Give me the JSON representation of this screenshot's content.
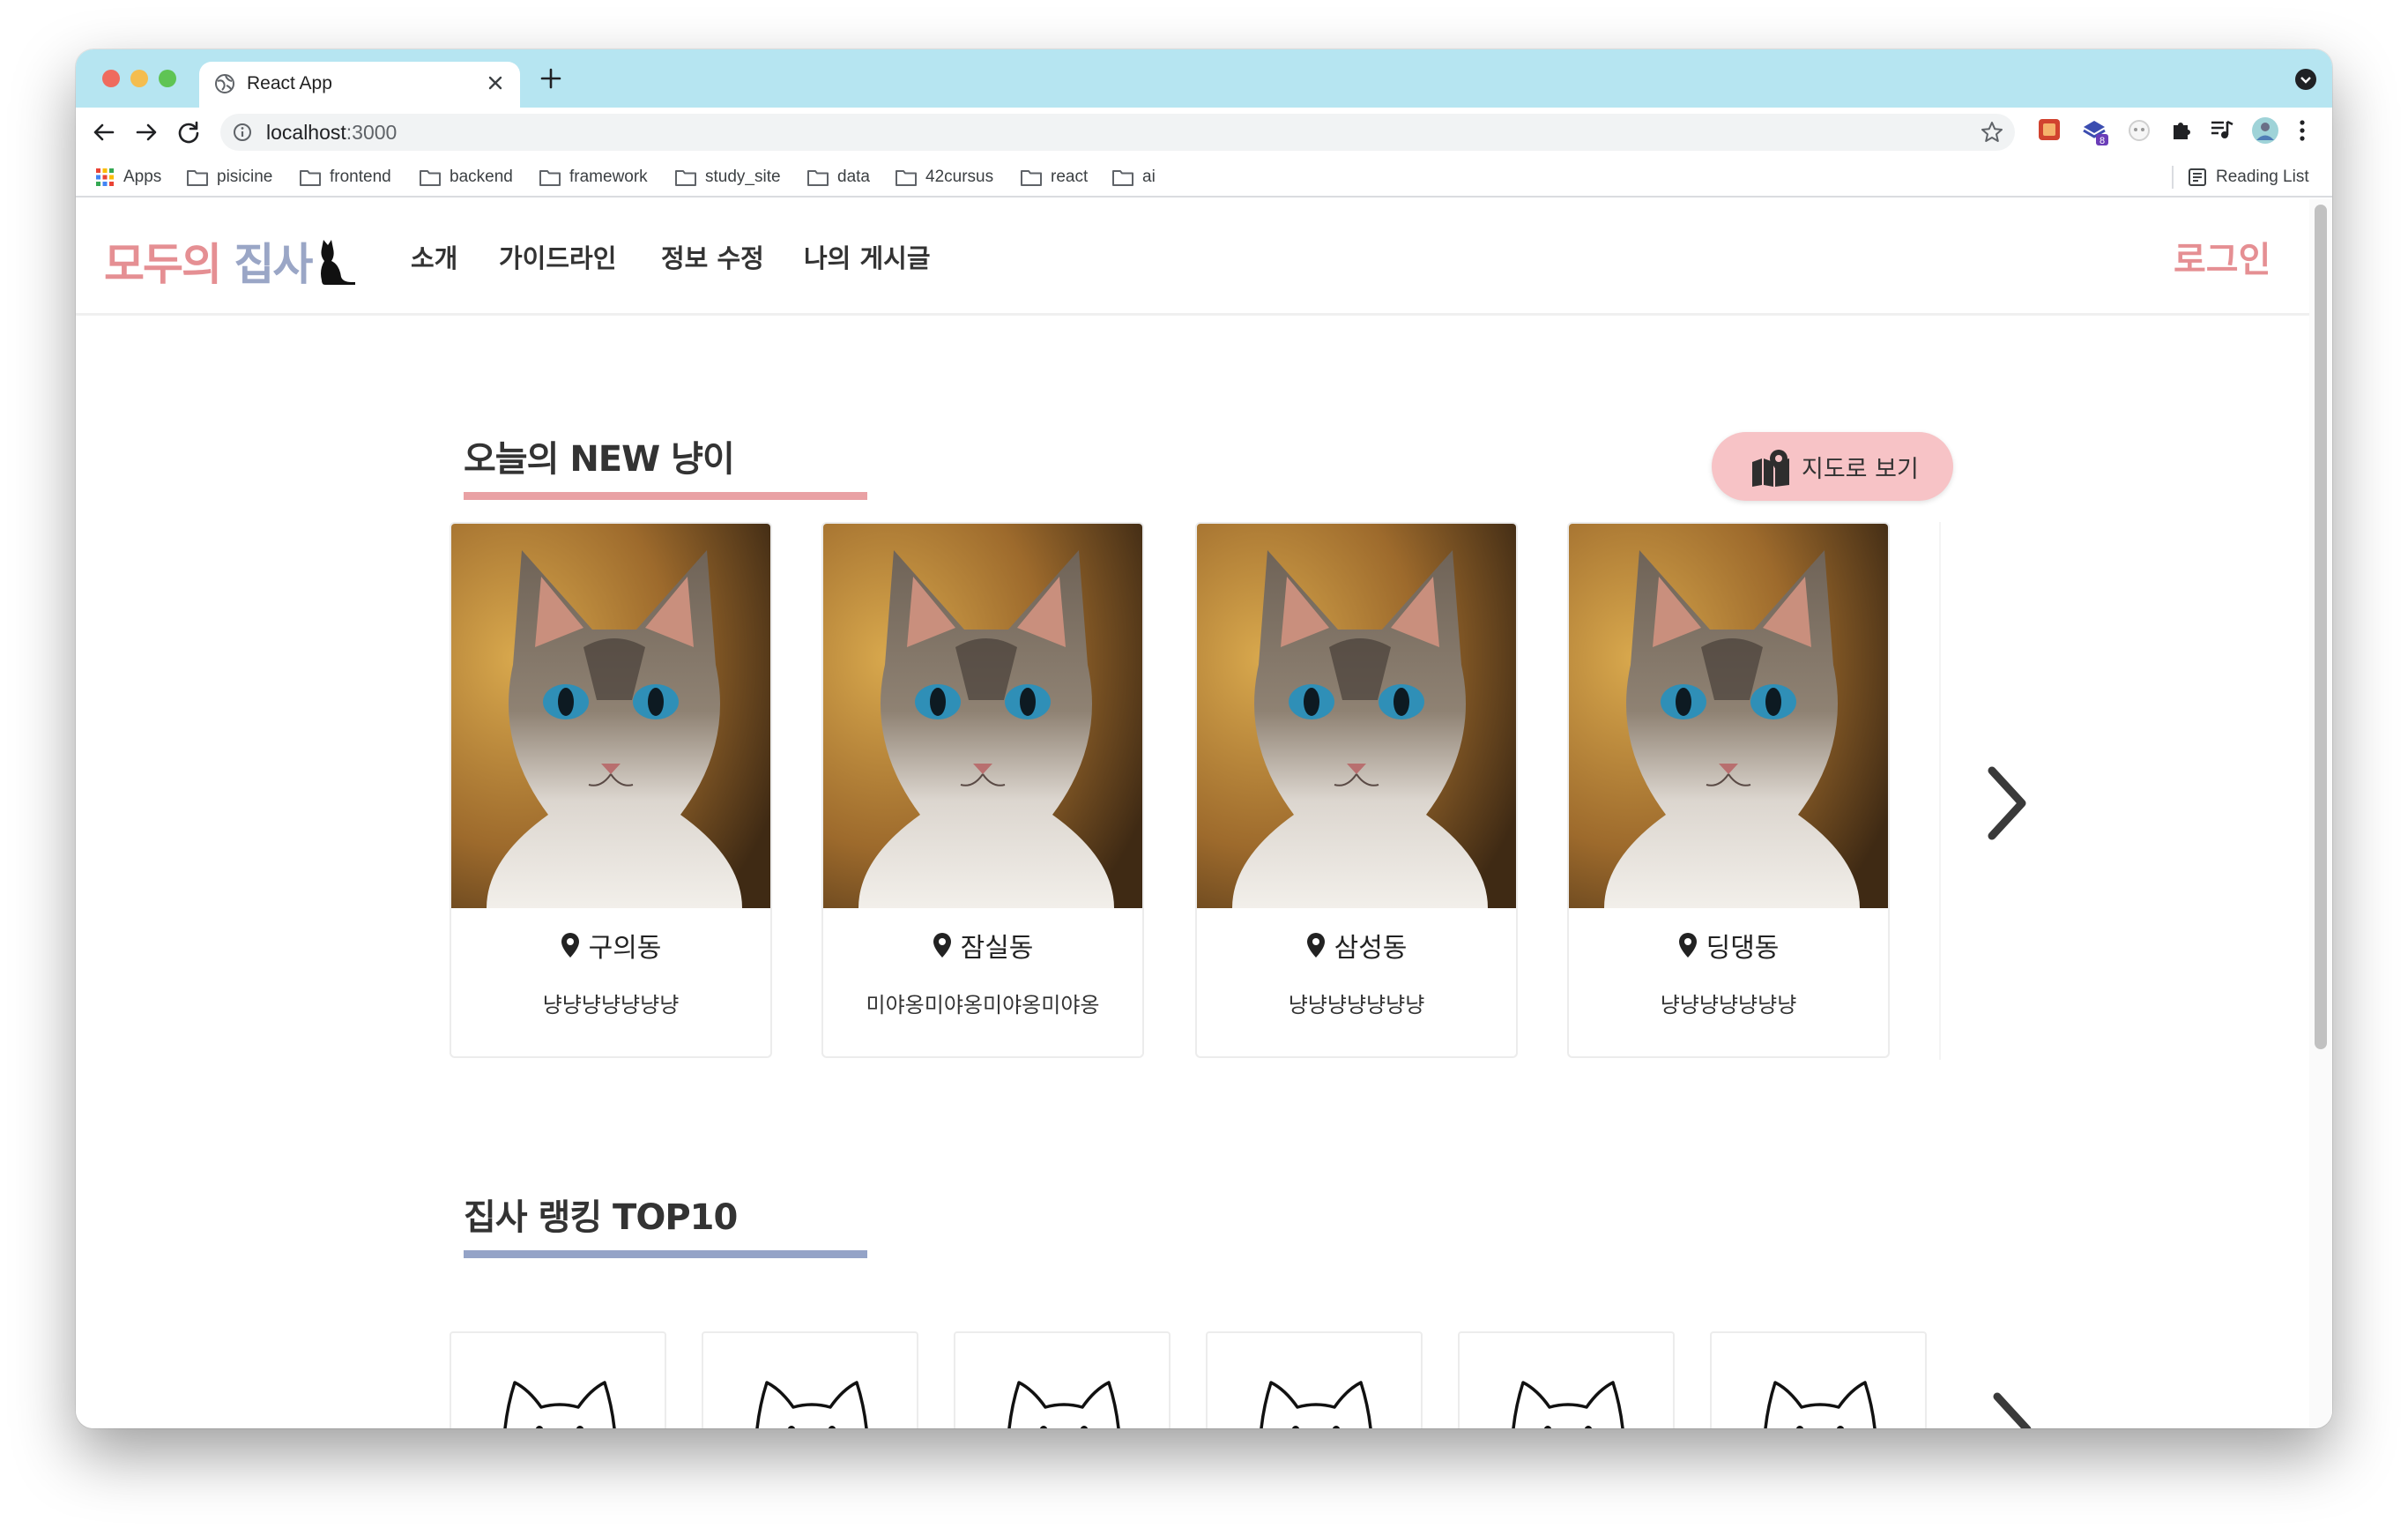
{
  "browser": {
    "tab_title": "React App",
    "url_host": "localhost",
    "url_port": ":3000",
    "bookmarks": [
      {
        "label": "Apps",
        "icon": "apps-grid-icon"
      },
      {
        "label": "pisicine",
        "icon": "folder-icon"
      },
      {
        "label": "frontend",
        "icon": "folder-icon"
      },
      {
        "label": "backend",
        "icon": "folder-icon"
      },
      {
        "label": "framework",
        "icon": "folder-icon"
      },
      {
        "label": "study_site",
        "icon": "folder-icon"
      },
      {
        "label": "data",
        "icon": "folder-icon"
      },
      {
        "label": "42cursus",
        "icon": "folder-icon"
      },
      {
        "label": "react",
        "icon": "folder-icon"
      },
      {
        "label": "ai",
        "icon": "folder-icon"
      }
    ],
    "reading_list": "Reading List",
    "extension_badge": "8"
  },
  "site": {
    "logo_part1": "모두의 ",
    "logo_part2": "집사",
    "nav": [
      "소개",
      "가이드라인",
      "정보 수정",
      "나의 게시글"
    ],
    "login": "로그인"
  },
  "today_section": {
    "title": "오늘의 NEW 냥이",
    "map_button": "지도로 보기",
    "cards": [
      {
        "location": "구의동",
        "description": "냥냥냥냥냥냥냥"
      },
      {
        "location": "잠실동",
        "description": "미야옹미야옹미야옹미야옹"
      },
      {
        "location": "삼성동",
        "description": "냥냥냥냥냥냥냥"
      },
      {
        "location": "딩댕동",
        "description": "냥냥냥냥냥냥냥"
      }
    ]
  },
  "ranking_section": {
    "title": "집사 랭킹 TOP10"
  },
  "colors": {
    "accent_pink": "#e58f93",
    "accent_blue": "#9aa6c6",
    "map_button_bg": "#f7c3c6",
    "tabstrip_bg": "#b6e5f1"
  }
}
